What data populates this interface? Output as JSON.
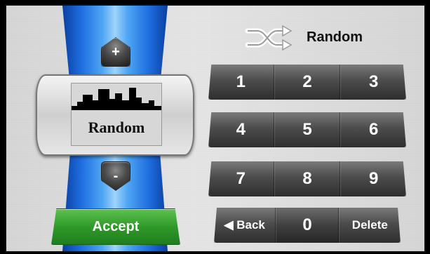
{
  "preset": {
    "plus_label": "+",
    "minus_label": "-",
    "name": "Random",
    "accept_label": "Accept"
  },
  "header": {
    "icon": "shuffle-icon",
    "title": "Random"
  },
  "keypad": {
    "rows": [
      [
        "1",
        "2",
        "3"
      ],
      [
        "4",
        "5",
        "6"
      ],
      [
        "7",
        "8",
        "9"
      ]
    ],
    "back_label": "◀ Back",
    "zero_label": "0",
    "delete_label": "Delete"
  },
  "colors": {
    "accent_blue": "#1f6ee0",
    "accept_green": "#2f9a2a",
    "key_dark": "#4c4c4c"
  }
}
